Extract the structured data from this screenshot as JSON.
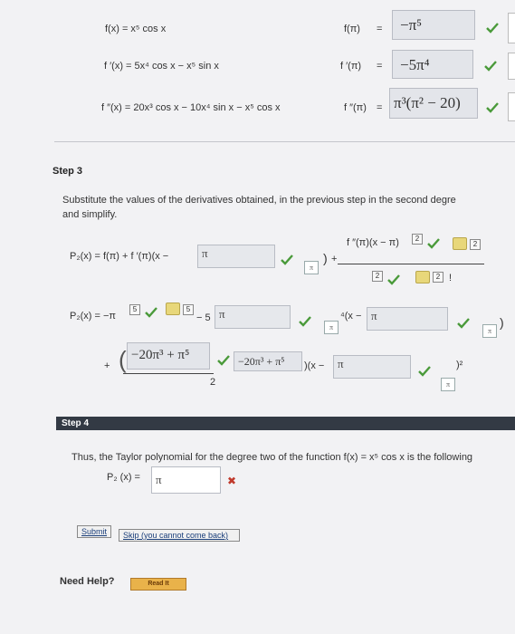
{
  "derivatives": {
    "f_label": "f(x) = x⁵ cos x",
    "f_pi_label": "f(π)",
    "f_pi_answer": "−π⁵",
    "f1_label": "f ′(x) = 5x⁴ cos x − x⁵ sin x",
    "f1_pi_label": "f ′(π)",
    "f1_pi_answer": "−5π⁴",
    "f2_label": "f ″(x) = 20x³ cos x − 10x⁴ sin x − x⁵ cos x",
    "f2_pi_label": "f ″(π)",
    "f2_pi_answer": "π³(π² − 20)",
    "equals": "="
  },
  "step3": {
    "title": "Step 3",
    "instruction_line1": "Substitute the values of the derivatives obtained, in the previous step in the second degre",
    "instruction_line2": "and simplify.",
    "p2_formula_left": "P₂(x)  =  f(π) + f ′(π)(x −",
    "p2_input_value": "π",
    "pi_symbol": "π",
    "close_paren": ")",
    "plus": "+",
    "numerator": "f ″(π)(x − π)",
    "mini_two": "2",
    "mini_five": "5",
    "factorial_mark": "!",
    "line2_left": "P₂(x)  =  −π",
    "line2_mid": "− 5",
    "x_minus": "⁴(x −",
    "line3_plus": "+",
    "line3_numerator": "−20π³ + π⁵",
    "line3_answer": "−20π³ + π⁵",
    "line3_denominator": "2",
    "line3_x": ")(x −",
    "square": ")²"
  },
  "step4": {
    "title": "Step 4",
    "text": "Thus, the Taylor polynomial for the degree two of the function f(x) = x⁵ cos x is the following",
    "p2_label": "P₂ (x)  =",
    "p2_value": "π",
    "wrong_mark": "✖"
  },
  "actions": {
    "submit": "Submit",
    "skip": "Skip (you cannot come back)"
  },
  "help": {
    "label": "Need Help?",
    "read_it": "Read It"
  },
  "colors": {
    "correct": "#4a9a3a",
    "wrong": "#c0392b"
  }
}
